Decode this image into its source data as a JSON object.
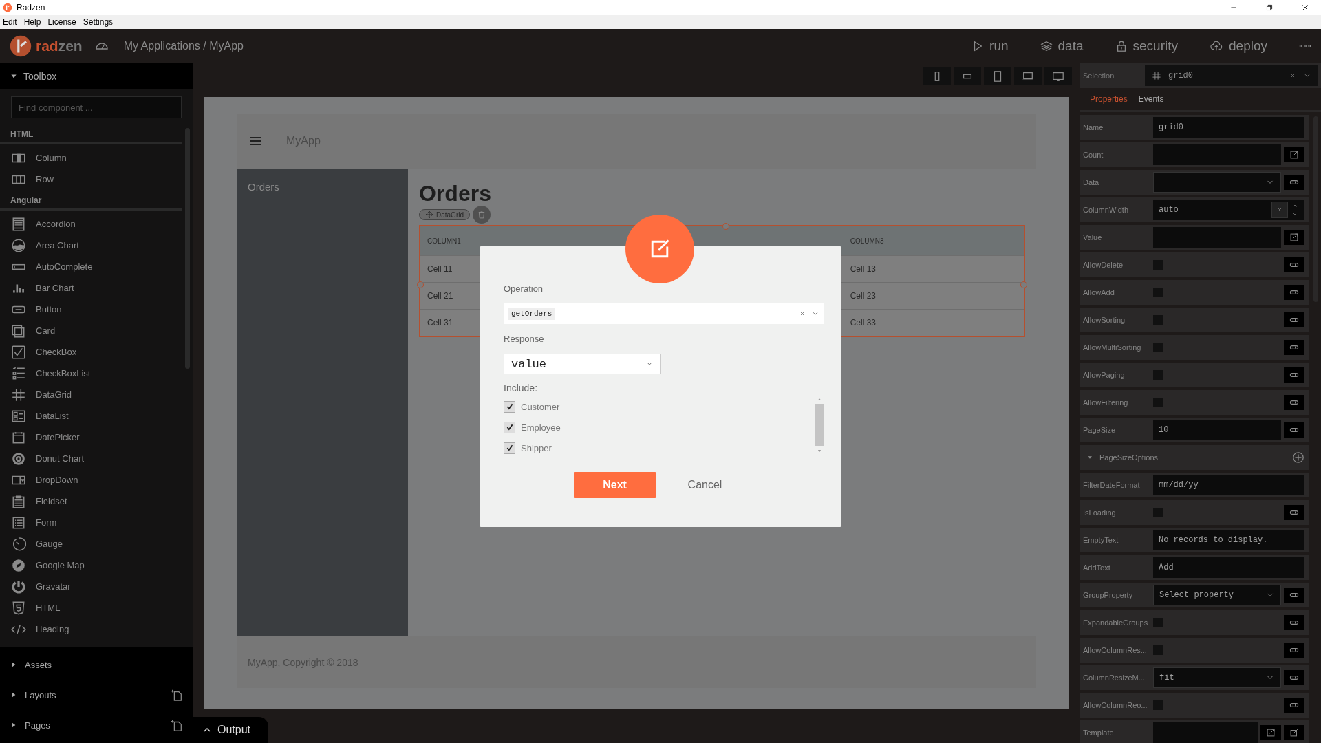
{
  "window": {
    "title": "Radzen"
  },
  "menu": [
    "Edit",
    "Help",
    "License",
    "Settings"
  ],
  "topbar": {
    "logo": [
      "rad",
      "zen"
    ],
    "breadcrumb": "My Applications / MyApp",
    "nav": [
      {
        "label": "run"
      },
      {
        "label": "data"
      },
      {
        "label": "security"
      },
      {
        "label": "deploy"
      }
    ]
  },
  "toolbox": {
    "title": "Toolbox",
    "search": {
      "placeholder": "Find component ..."
    },
    "sections": [
      {
        "title": "HTML",
        "items": [
          {
            "label": "Column"
          },
          {
            "label": "Row"
          }
        ]
      },
      {
        "title": "Angular",
        "items": [
          {
            "label": "Accordion"
          },
          {
            "label": "Area Chart"
          },
          {
            "label": "AutoComplete"
          },
          {
            "label": "Bar Chart"
          },
          {
            "label": "Button"
          },
          {
            "label": "Card"
          },
          {
            "label": "CheckBox"
          },
          {
            "label": "CheckBoxList"
          },
          {
            "label": "DataGrid"
          },
          {
            "label": "DataList"
          },
          {
            "label": "DatePicker"
          },
          {
            "label": "Donut Chart"
          },
          {
            "label": "DropDown"
          },
          {
            "label": "Fieldset"
          },
          {
            "label": "Form"
          },
          {
            "label": "Gauge"
          },
          {
            "label": "Google Map"
          },
          {
            "label": "Gravatar"
          },
          {
            "label": "HTML"
          },
          {
            "label": "Heading"
          }
        ]
      }
    ]
  },
  "panels": [
    {
      "label": "Assets",
      "add": false
    },
    {
      "label": "Layouts",
      "add": true
    },
    {
      "label": "Pages",
      "add": true
    }
  ],
  "output": {
    "label": "Output"
  },
  "canvas": {
    "app_title": "MyApp",
    "nav": [
      {
        "label": "Orders"
      }
    ],
    "heading": "Orders",
    "component_badge": "DataGrid",
    "footer": "MyApp, Copyright © 2018",
    "grid": {
      "columns": [
        {
          "label": "COLUMN1"
        },
        {
          "label": "COLUMN3"
        }
      ],
      "rows": [
        [
          "Cell 11",
          "Cell 13"
        ],
        [
          "Cell 21",
          "Cell 23"
        ],
        [
          "Cell 31",
          "Cell 33"
        ]
      ]
    }
  },
  "dialog": {
    "operation": {
      "label": "Operation",
      "value": "getOrders"
    },
    "response": {
      "label": "Response",
      "value": "value"
    },
    "include": {
      "label": "Include:",
      "items": [
        {
          "label": "Customer",
          "checked": true
        },
        {
          "label": "Employee",
          "checked": true
        },
        {
          "label": "Shipper",
          "checked": true
        }
      ]
    },
    "buttons": [
      {
        "label": "Next",
        "kind": "primary"
      },
      {
        "label": "Cancel",
        "kind": "link"
      }
    ]
  },
  "inspector": {
    "selection": {
      "label": "Selection",
      "value": "grid0"
    },
    "tabs": [
      {
        "label": "Properties",
        "selected": true
      },
      {
        "label": "Events",
        "selected": false
      }
    ],
    "properties": [
      {
        "label": "Name",
        "kind": "text",
        "value": "grid0"
      },
      {
        "label": "Count",
        "kind": "text",
        "edit_button": true
      },
      {
        "label": "Data",
        "kind": "dropdown",
        "link_button": true
      },
      {
        "label": "ColumnWidth",
        "kind": "number",
        "value": "auto"
      },
      {
        "label": "Value",
        "kind": "text",
        "edit_button": true
      },
      {
        "label": "AllowDelete",
        "kind": "checkbox",
        "checked": false,
        "link_button": true
      },
      {
        "label": "AllowAdd",
        "kind": "checkbox",
        "checked": false,
        "link_button": true
      },
      {
        "label": "AllowSorting",
        "kind": "checkbox",
        "checked": false,
        "link_button": true
      },
      {
        "label": "AllowMultiSorting",
        "kind": "checkbox",
        "checked": false,
        "link_button": true
      },
      {
        "label": "AllowPaging",
        "kind": "checkbox",
        "checked": false,
        "link_button": true
      },
      {
        "label": "AllowFiltering",
        "kind": "checkbox",
        "checked": false,
        "link_button": true
      },
      {
        "label": "PageSize",
        "kind": "text",
        "value": "10",
        "link_button": true
      },
      {
        "label": "PageSizeOptions",
        "kind": "group"
      },
      {
        "label": "FilterDateFormat",
        "kind": "text",
        "value": "mm/dd/yy"
      },
      {
        "label": "IsLoading",
        "kind": "checkbox",
        "checked": false,
        "link_button": true
      },
      {
        "label": "EmptyText",
        "kind": "text",
        "value": "No records to display."
      },
      {
        "label": "AddText",
        "kind": "text",
        "value": "Add"
      },
      {
        "label": "GroupProperty",
        "kind": "dropdown",
        "placeholder": "Select property",
        "link_button": true
      },
      {
        "label": "ExpandableGroups",
        "kind": "checkbox",
        "checked": false,
        "link_button": true
      },
      {
        "label": "AllowColumnRes...",
        "kind": "checkbox",
        "checked": false,
        "link_button": true
      },
      {
        "label": "ColumnResizeM...",
        "kind": "dropdown",
        "value": "fit",
        "link_button": true
      },
      {
        "label": "AllowColumnReo...",
        "kind": "checkbox",
        "checked": false,
        "link_button": true
      },
      {
        "label": "Template",
        "kind": "text",
        "edit_button": true,
        "template_button": true
      }
    ]
  }
}
